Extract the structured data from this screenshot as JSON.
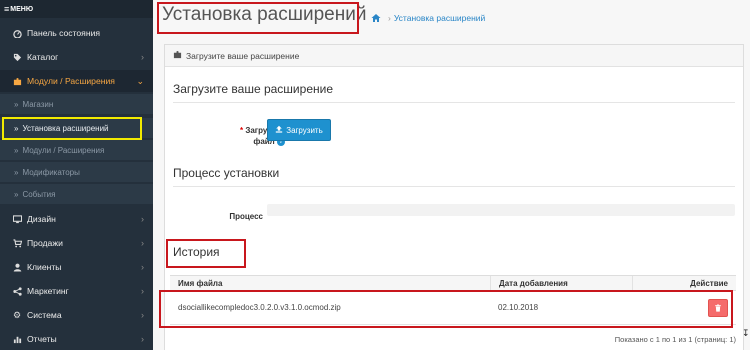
{
  "sidebar": {
    "menu_label": "МЕНЮ",
    "items": [
      {
        "label": "Панель состояния",
        "icon": "dashboard-icon"
      },
      {
        "label": "Каталог",
        "icon": "tag-icon"
      },
      {
        "label": "Модули / Расширения",
        "icon": "puzzle-icon"
      },
      {
        "label": "Дизайн",
        "icon": "monitor-icon"
      },
      {
        "label": "Продажи",
        "icon": "cart-icon"
      },
      {
        "label": "Клиенты",
        "icon": "user-icon"
      },
      {
        "label": "Маркетинг",
        "icon": "share-icon"
      },
      {
        "label": "Система",
        "icon": "gear-icon"
      },
      {
        "label": "Отчеты",
        "icon": "chart-icon"
      }
    ],
    "subitems": [
      {
        "label": "Магазин"
      },
      {
        "label": "Установка расширений"
      },
      {
        "label": "Модули / Расширения"
      },
      {
        "label": "Модификаторы"
      },
      {
        "label": "События"
      }
    ]
  },
  "header": {
    "title": "Установка расширений",
    "breadcrumb": "Установка расширений"
  },
  "panel": {
    "heading": "Загрузите ваше расширение",
    "upload_section": "Загрузите ваше расширение",
    "upload_label_line1": "Загрузить",
    "upload_label_line2": "файл",
    "upload_button": "Загрузить",
    "process_section": "Процесс установки",
    "process_label": "Процесс",
    "history_section": "История"
  },
  "history_table": {
    "columns": [
      "Имя файла",
      "Дата добавления",
      "Действие"
    ],
    "rows": [
      {
        "filename": "dsociallikecompledoc3.0.2.0.v3.1.0.ocmod.zip",
        "date": "02.10.2018"
      }
    ],
    "pagination": "Показано с 1 по 1 из 1 (страниц: 1)"
  },
  "colors": {
    "sidebar_bg": "#24303c",
    "accent_orange": "#f7a743",
    "primary_blue": "#1e91cf",
    "danger_red": "#f56b6b",
    "highlight_red": "#c8171d",
    "highlight_yellow": "#f2ea00"
  }
}
